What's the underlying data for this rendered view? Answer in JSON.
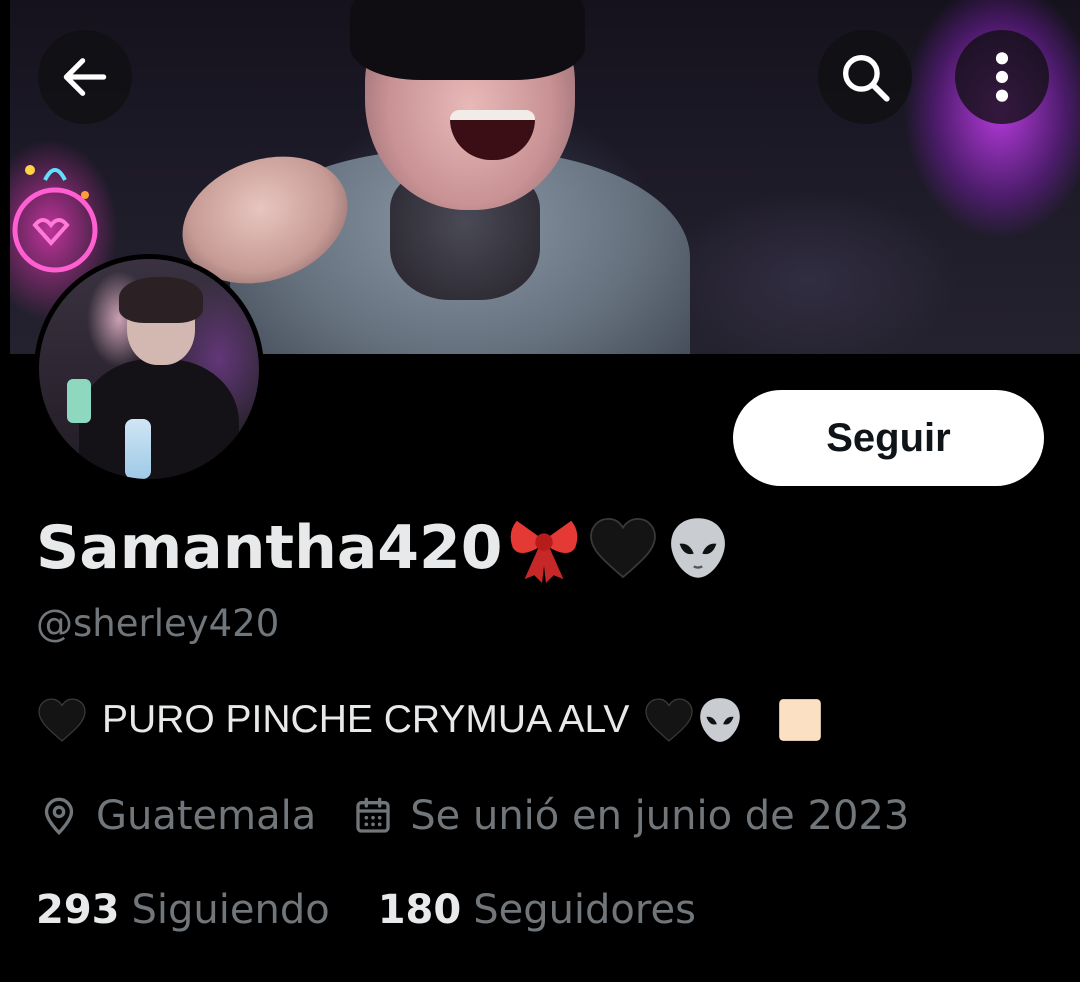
{
  "header": {
    "back_icon": "arrow-left-icon",
    "search_icon": "search-icon",
    "more_icon": "more-vertical-icon"
  },
  "profile": {
    "display_name": "Samantha420",
    "display_name_emojis": [
      "ribbon",
      "black-heart",
      "alien"
    ],
    "handle": "@sherley420",
    "bio_text": "PURO PINCHE CRYMUA ALV",
    "follow_label": "Seguir",
    "location": "Guatemala",
    "joined": "Se unió en junio de 2023",
    "following_count": "293",
    "following_label": "Siguiendo",
    "followers_count": "180",
    "followers_label": "Seguidores"
  },
  "colors": {
    "background": "#000000",
    "primary_text": "#e7e9ea",
    "secondary_text": "#71767b",
    "follow_button_bg": "#ffffff"
  }
}
